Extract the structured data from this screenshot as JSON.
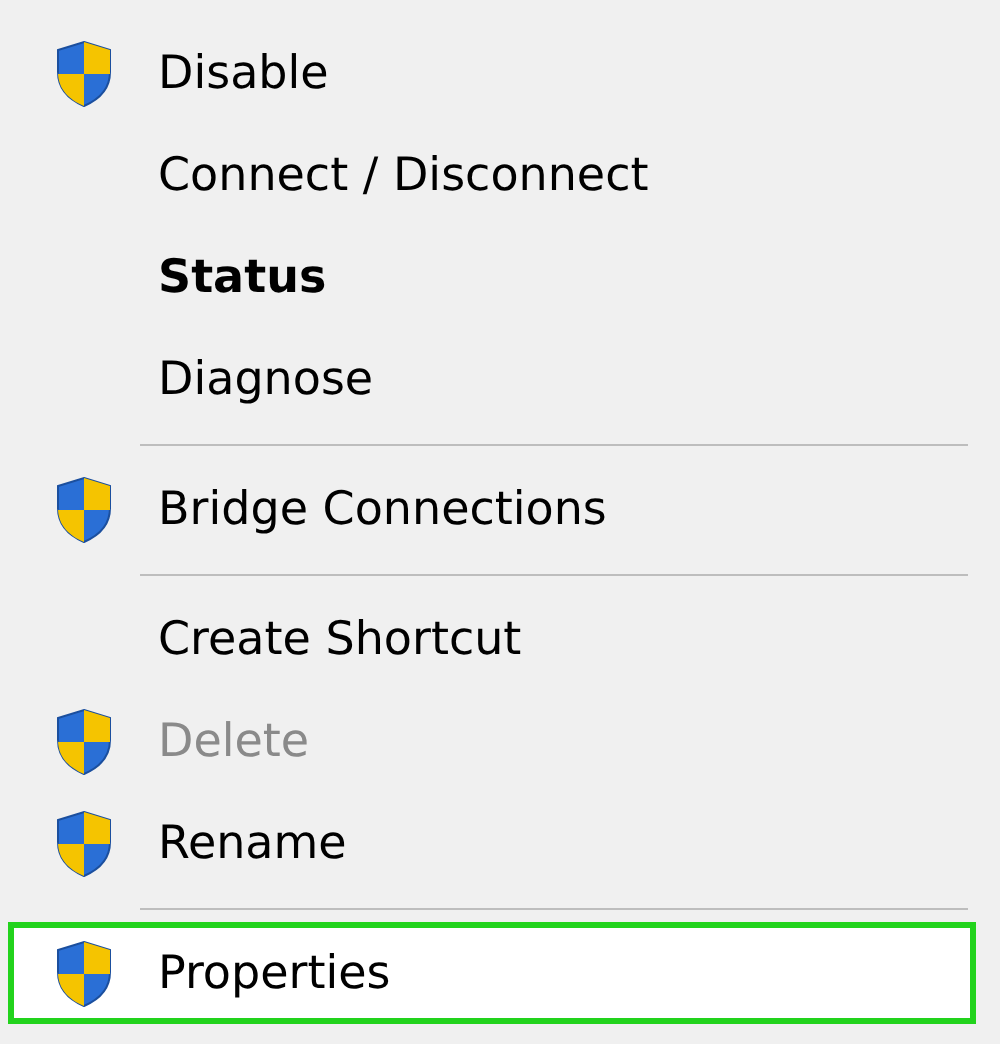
{
  "menu": {
    "items": [
      {
        "kind": "item",
        "label": "Disable",
        "shield": true,
        "bold": false,
        "disabled": false,
        "selected": false
      },
      {
        "kind": "item",
        "label": "Connect / Disconnect",
        "shield": false,
        "bold": false,
        "disabled": false,
        "selected": false
      },
      {
        "kind": "item",
        "label": "Status",
        "shield": false,
        "bold": true,
        "disabled": false,
        "selected": false
      },
      {
        "kind": "item",
        "label": "Diagnose",
        "shield": false,
        "bold": false,
        "disabled": false,
        "selected": false
      },
      {
        "kind": "separator"
      },
      {
        "kind": "item",
        "label": "Bridge Connections",
        "shield": true,
        "bold": false,
        "disabled": false,
        "selected": false
      },
      {
        "kind": "separator"
      },
      {
        "kind": "item",
        "label": "Create Shortcut",
        "shield": false,
        "bold": false,
        "disabled": false,
        "selected": false
      },
      {
        "kind": "item",
        "label": "Delete",
        "shield": true,
        "bold": false,
        "disabled": true,
        "selected": false
      },
      {
        "kind": "item",
        "label": "Rename",
        "shield": true,
        "bold": false,
        "disabled": false,
        "selected": false
      },
      {
        "kind": "separator"
      },
      {
        "kind": "item",
        "label": "Properties",
        "shield": true,
        "bold": false,
        "disabled": false,
        "selected": true
      }
    ]
  }
}
